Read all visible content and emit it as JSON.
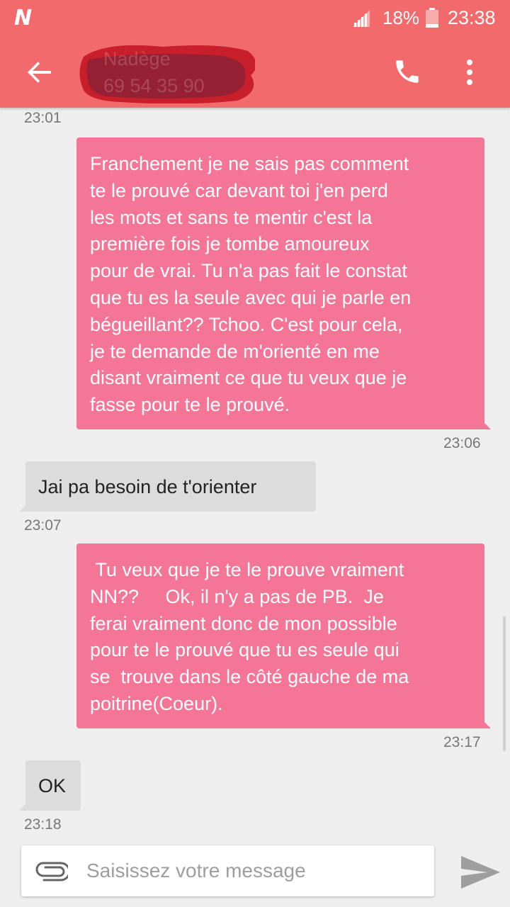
{
  "status_bar": {
    "app_logo": "N",
    "battery": "18%",
    "time": "23:38"
  },
  "header": {
    "contact_name": "Nadège",
    "contact_number": "69 54 35 90",
    "icons": [
      "back-arrow-icon",
      "phone-icon",
      "more-vert-icon"
    ]
  },
  "conversation": {
    "top_timestamp": "23:01",
    "messages": [
      {
        "direction": "outgoing",
        "text": "Franchement je ne sais pas comment\nte le prouvé car devant toi j'en perd\nles mots et sans te mentir c'est la\npremière fois je tombe amoureux\npour de vrai. Tu n'a pas fait le constat\nque tu es la seule avec qui je parle en\nbégueillant?? Tchoo. C'est pour cela,\nje te demande de m'orienté en me\ndisant vraiment ce que tu veux que je\nfasse pour te le prouvé.",
        "time": "23:06"
      },
      {
        "direction": "incoming",
        "text": "Jai pa besoin de t'orienter",
        "time": "23:07"
      },
      {
        "direction": "outgoing",
        "text": " Tu veux que je te le prouve vraiment\nNN??     Ok, il n'y a pas de PB.  Je\nferai vraiment donc de mon possible\npour te le prouvé que tu es seule qui\nse  trouve dans le côté gauche de ma\npoitrine(Coeur).",
        "time": "23:17"
      },
      {
        "direction": "incoming",
        "text": "OK",
        "time": "23:18"
      }
    ]
  },
  "composer": {
    "placeholder": "Saisissez votre message",
    "icons": [
      "attach-icon",
      "send-icon"
    ]
  },
  "colors": {
    "header": "#f26a6b",
    "outgoing_bubble": "#f57597",
    "incoming_bubble": "#dcdcdc",
    "background": "#eeeeee"
  }
}
